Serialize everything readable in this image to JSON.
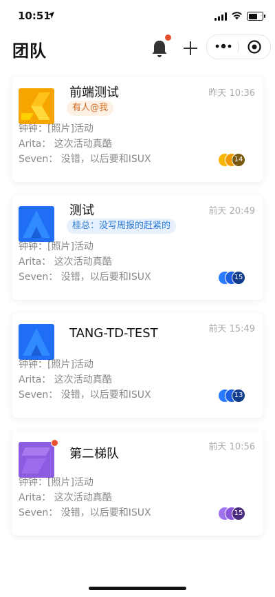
{
  "status_bar": {
    "time": "10:51"
  },
  "header": {
    "title": "团队"
  },
  "teams": [
    {
      "name": "前端测试",
      "time": "昨天 10:36",
      "badge": "有人@我",
      "messages": [
        "钟钟：[照片]活动",
        "Arita： 这次活动真酷",
        "Seven： 没错，以后要和ISUX"
      ],
      "member_count": "14",
      "logo_color": "#f5a400",
      "avatar_color": "#f0a000"
    },
    {
      "name": "测试",
      "time": "前天 20:49",
      "badge": "桂总：没写周报的赶紧的",
      "messages": [
        "钟钟：[照片]活动",
        "Arita： 这次活动真酷",
        "Seven： 没错，以后要和ISUX"
      ],
      "member_count": "15",
      "logo_color": "#1f6ef5",
      "avatar_color": "#1f5ee0"
    },
    {
      "name": "TANG-TD-TEST",
      "time": "前天 15:49",
      "messages": [
        "钟钟：[照片]活动",
        "Arita： 这次活动真酷",
        "Seven： 没错，以后要和ISUX"
      ],
      "member_count": "13",
      "logo_color": "#1f6ef5",
      "avatar_color": "#1f5ee0"
    },
    {
      "name": "第二梯队",
      "time": "前天 10:56",
      "messages": [
        "钟钟：[照片]活动",
        "Arita： 这次活动真酷",
        "Seven： 没错，以后要和ISUX"
      ],
      "member_count": "15",
      "logo_color": "#8b5be0",
      "avatar_color": "#8a55d8"
    }
  ],
  "colors": {
    "notification_dot": "#e8502f",
    "accent_blue": "#2a7bd8",
    "accent_orange": "#d2671e"
  }
}
